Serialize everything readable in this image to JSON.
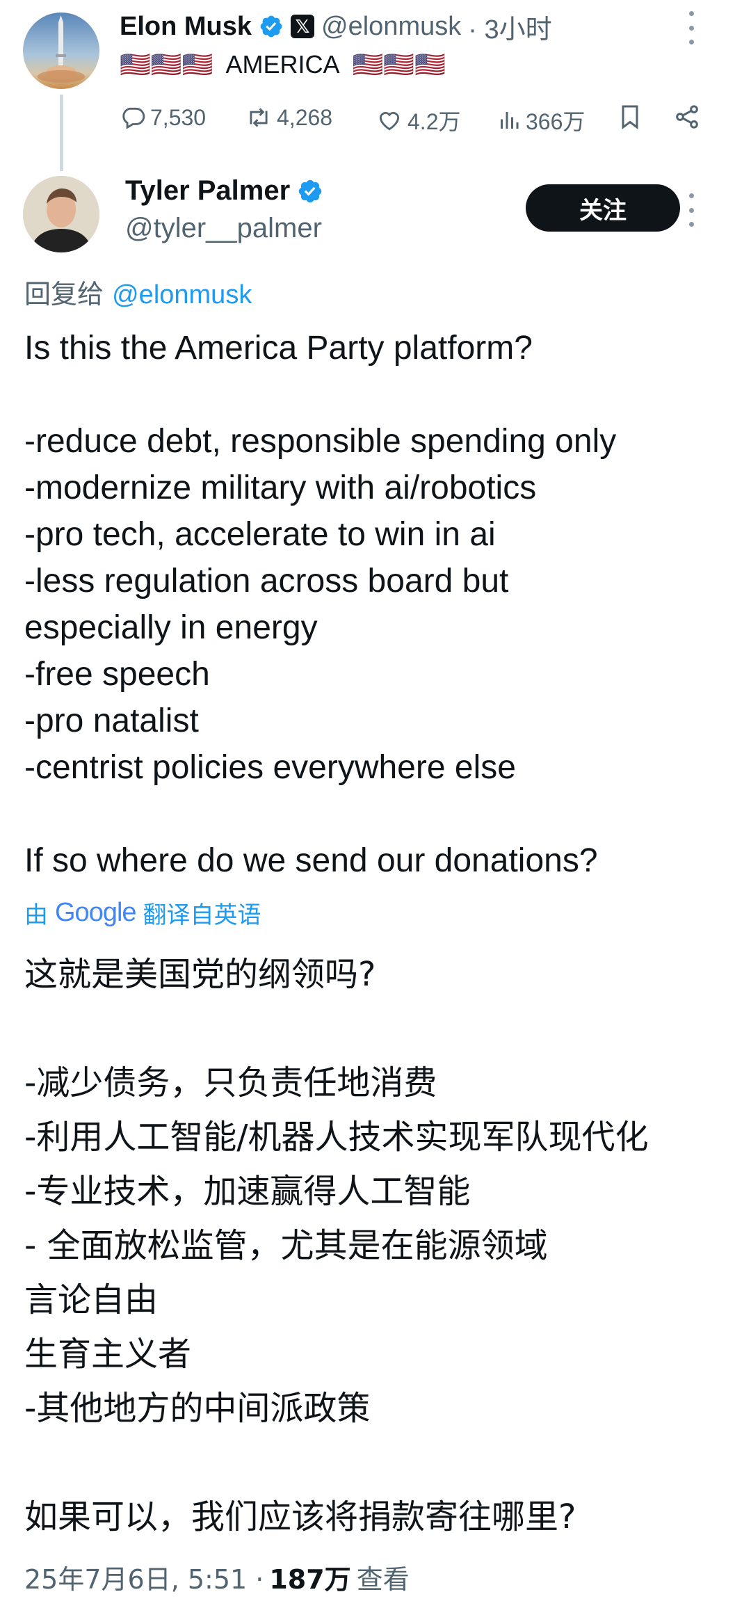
{
  "original": {
    "name": "Elon Musk",
    "handle": "@elonmusk",
    "time": "· 3小时",
    "text": "🇺🇸🇺🇸🇺🇸  AMERICA  🇺🇸🇺🇸🇺🇸",
    "actions": {
      "replies": "7,530",
      "reposts": "4,268",
      "likes": "4.2万",
      "views": "366万"
    }
  },
  "reply": {
    "name": "Tyler Palmer",
    "handle": "@tyler__palmer",
    "follow_label": "关注",
    "reply_to_prefix": "回复给",
    "reply_to_handle": "@elonmusk",
    "text_lines": [
      "Is this the America Party platform?",
      "",
      "-reduce debt, responsible spending only",
      "-modernize military with ai/robotics",
      "-pro tech, accelerate to win in ai",
      "-less regulation across board but",
      "especially in energy",
      "-free speech",
      "-pro natalist",
      "-centrist policies everywhere else",
      "",
      "If so where do we send our donations?"
    ],
    "translate_prefix": "由",
    "translate_brand": "Google",
    "translate_suffix": "翻译自英语",
    "translated_lines": [
      "这就是美国党的纲领吗?",
      "",
      "-减少债务，只负责任地消费",
      "-利用人工智能/机器人技术实现军队现代化",
      "-专业技术，加速赢得人工智能",
      "- 全面放松监管，尤其是在能源领域",
      "言论自由",
      "生育主义者",
      "-其他地方的中间派政策",
      "",
      "如果可以，我们应该将捐款寄往哪里?"
    ],
    "timestamp": "25年7月6日, 5:51 ·",
    "views_count": "187万",
    "views_label": "查看"
  },
  "colors": {
    "accent": "#1d9bf0",
    "text": "#0f1419",
    "muted": "#536471",
    "verified": "#1d9bf0"
  },
  "icons": [
    "reply-icon",
    "repost-icon",
    "like-icon",
    "views-icon",
    "bookmark-icon",
    "share-icon",
    "more-icon",
    "verified-icon",
    "x-logo-icon"
  ]
}
